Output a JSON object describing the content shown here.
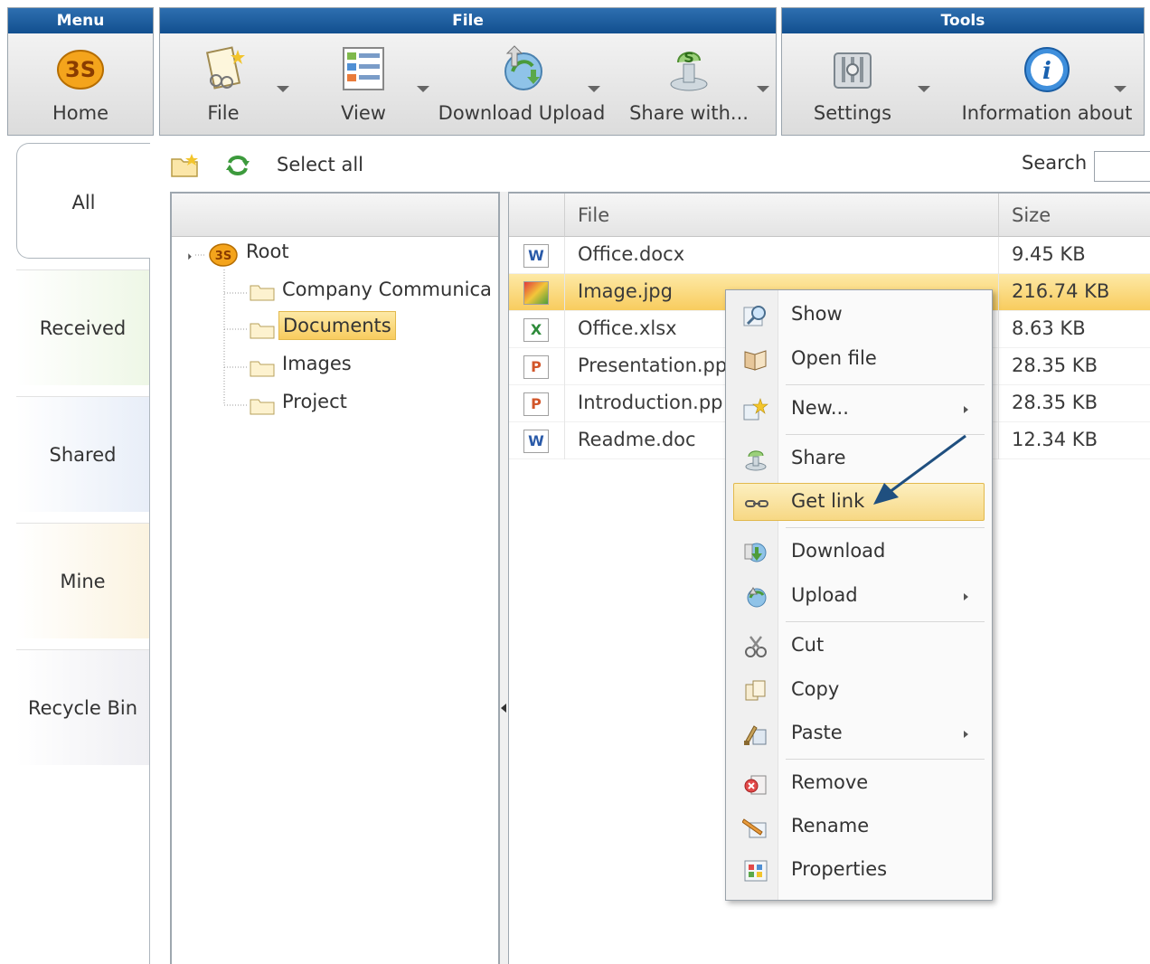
{
  "ribbon": {
    "menu_group": {
      "title": "Menu",
      "home": "Home"
    },
    "file_group": {
      "title": "File",
      "file": "File",
      "view": "View",
      "download_upload": "Download Upload",
      "share_with": "Share with..."
    },
    "tools_group": {
      "title": "Tools",
      "settings": "Settings",
      "information": "Information about"
    }
  },
  "tabs": [
    {
      "label": "All"
    },
    {
      "label": "Received"
    },
    {
      "label": "Shared"
    },
    {
      "label": "Mine"
    },
    {
      "label": "Recycle Bin"
    }
  ],
  "toolbar": {
    "select_all": "Select all",
    "search_label": "Search",
    "search_value": ""
  },
  "tree": {
    "root": "Root",
    "children": [
      "Company Communica",
      "Documents",
      "Images",
      "Project"
    ],
    "selected": "Documents"
  },
  "list": {
    "headers": {
      "file": "File",
      "size": "Size"
    },
    "rows": [
      {
        "name": "Office.docx",
        "size": "9.45 KB",
        "type": "W"
      },
      {
        "name": "Image.jpg",
        "size": "216.74 KB",
        "type": "img"
      },
      {
        "name": "Office.xlsx",
        "size": "8.63 KB",
        "type": "X"
      },
      {
        "name": "Presentation.pp",
        "size": "28.35 KB",
        "type": "P"
      },
      {
        "name": "Introduction.pp",
        "size": "28.35 KB",
        "type": "P"
      },
      {
        "name": "Readme.doc",
        "size": "12.34 KB",
        "type": "W"
      }
    ],
    "selected_row": "Image.jpg"
  },
  "context_menu": {
    "items": [
      {
        "label": "Show",
        "icon": "magnifier-icon"
      },
      {
        "label": "Open file",
        "icon": "open-book-icon"
      },
      {
        "label": "New...",
        "icon": "new-star-icon"
      },
      {
        "label": "Share",
        "icon": "share-icon"
      },
      {
        "label": "Get link",
        "icon": "link-icon"
      },
      {
        "label": "Download",
        "icon": "download-icon"
      },
      {
        "label": "Upload",
        "icon": "upload-icon"
      },
      {
        "label": "Cut",
        "icon": "scissors-icon"
      },
      {
        "label": "Copy",
        "icon": "copy-icon"
      },
      {
        "label": "Paste",
        "icon": "paste-icon"
      },
      {
        "label": "Remove",
        "icon": "remove-icon"
      },
      {
        "label": "Rename",
        "icon": "rename-icon"
      },
      {
        "label": "Properties",
        "icon": "properties-icon"
      }
    ],
    "highlighted": "Get link"
  },
  "colors": {
    "ribbon_header": "#1d5a98",
    "selection": "#f8cc5e",
    "arrow": "#1f4f7f"
  }
}
